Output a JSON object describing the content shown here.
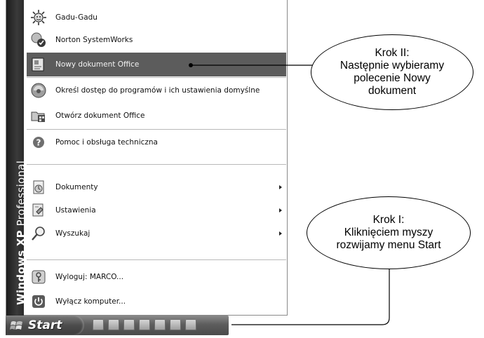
{
  "start_menu": {
    "side_banner": {
      "brand": "Windows XP",
      "edition": "Professional"
    },
    "items": [
      {
        "label": "Gadu-Gadu",
        "icon": "gadu-gadu-icon"
      },
      {
        "label": "Norton SystemWorks",
        "icon": "norton-systemworks-icon"
      },
      {
        "label": "Nowy dokument Office",
        "icon": "new-office-document-icon",
        "highlighted": true
      },
      {
        "label": "Określ dostęp do programów i ich ustawienia domyślne",
        "icon": "program-access-icon"
      },
      {
        "label": "Otwórz dokument Office",
        "icon": "open-office-document-icon"
      },
      {
        "label": "Pomoc i obsługa techniczna",
        "icon": "help-icon"
      },
      {
        "label": "Dokumenty",
        "icon": "documents-icon",
        "submenu": true
      },
      {
        "label": "Ustawienia",
        "icon": "settings-icon",
        "submenu": true
      },
      {
        "label": "Wyszukaj",
        "icon": "search-icon",
        "submenu": true
      },
      {
        "label": "Wyloguj: MARCO...",
        "icon": "log-off-icon"
      },
      {
        "label": "Wyłącz komputer...",
        "icon": "shutdown-icon"
      }
    ]
  },
  "taskbar": {
    "start_label": "Start",
    "quick_launch": [
      "quick-launch-icon-1",
      "quick-launch-icon-2",
      "quick-launch-icon-3",
      "quick-launch-icon-4",
      "quick-launch-icon-5",
      "quick-launch-icon-6",
      "quick-launch-icon-7"
    ]
  },
  "callouts": {
    "step2": {
      "lines": [
        "Krok II:",
        "Następnie wybieramy",
        "polecenie Nowy",
        "dokument"
      ]
    },
    "step1": {
      "lines": [
        "Krok I:",
        "Kliknięciem myszy",
        "rozwijamy menu Start"
      ]
    }
  },
  "colors": {
    "highlight": "#5c5c5c",
    "banner": "#2a2a2a",
    "taskbar": "#5d5d5d"
  }
}
